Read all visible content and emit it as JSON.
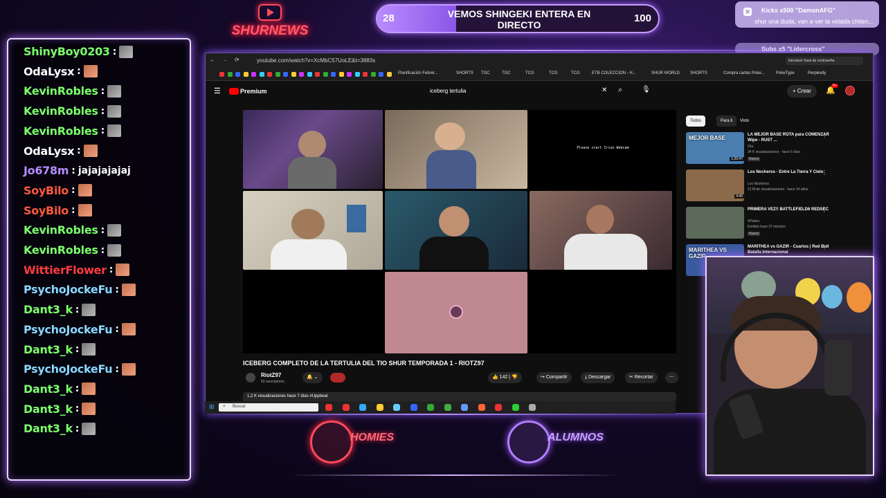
{
  "overlay": {
    "brand": "SHURNEWS",
    "goal": {
      "current": "28",
      "target": "100",
      "progress": 0.28,
      "title": "VEMOS SHINGEKI ENTERA EN DIRECTO"
    },
    "alerts": [
      {
        "title": "Kicks x500 \"DamonAFG\"",
        "message": "shur una duda, van a ver la velada chilen..."
      },
      {
        "title": "Subs x5 \"Lidercross\"",
        "message": ""
      }
    ],
    "teams": [
      "HOMIES",
      "ALUMNOS"
    ],
    "colors": {
      "accent": "#b98cff",
      "homies": "#ff4a5a",
      "alumnos": "#b47dff"
    }
  },
  "chat": [
    {
      "user": "ShinyBoy0203",
      "color": "#7dff6b",
      "msg": "",
      "emote": "gray"
    },
    {
      "user": "OdaLysx",
      "color": "#ffffff",
      "msg": "",
      "emote": "face"
    },
    {
      "user": "KevinRobles",
      "color": "#7dff6b",
      "msg": "",
      "emote": "gray"
    },
    {
      "user": "KevinRobles",
      "color": "#7dff6b",
      "msg": "",
      "emote": "gray"
    },
    {
      "user": "KevinRobles",
      "color": "#7dff6b",
      "msg": "",
      "emote": "gray"
    },
    {
      "user": "OdaLysx",
      "color": "#ffffff",
      "msg": "",
      "emote": "face"
    },
    {
      "user": "Jo678m",
      "color": "#b58cff",
      "msg": "jajajajajaj",
      "emote": ""
    },
    {
      "user": "SoyBilo",
      "color": "#ff5a3c",
      "msg": "",
      "emote": "face"
    },
    {
      "user": "SoyBilo",
      "color": "#ff5a3c",
      "msg": "",
      "emote": "face"
    },
    {
      "user": "KevinRobles",
      "color": "#7dff6b",
      "msg": "",
      "emote": "gray"
    },
    {
      "user": "KevinRobles",
      "color": "#7dff6b",
      "msg": "",
      "emote": "gray"
    },
    {
      "user": "WittierFlower",
      "color": "#ff3c3c",
      "msg": "",
      "emote": "face"
    },
    {
      "user": "PsychoJockeFu",
      "color": "#8ad7ff",
      "msg": "",
      "emote": "face"
    },
    {
      "user": "Dant3_k",
      "color": "#7dff6b",
      "msg": "",
      "emote": "gray"
    },
    {
      "user": "PsychoJockeFu",
      "color": "#8ad7ff",
      "msg": "",
      "emote": "face"
    },
    {
      "user": "Dant3_k",
      "color": "#7dff6b",
      "msg": "",
      "emote": "gray"
    },
    {
      "user": "PsychoJockeFu",
      "color": "#8ad7ff",
      "msg": "",
      "emote": "face"
    },
    {
      "user": "Dant3_k",
      "color": "#7dff6b",
      "msg": "",
      "emote": "face"
    },
    {
      "user": "Dant3_k",
      "color": "#7dff6b",
      "msg": "",
      "emote": "face"
    },
    {
      "user": "Dant3_k",
      "color": "#7dff6b",
      "msg": "",
      "emote": "gray"
    }
  ],
  "browser": {
    "url": "youtube.com/watch?v=XcMbC57UoLE&t=3883s",
    "bookmarks": [
      "Planificación Febrer...",
      "SHORTS",
      "TGC",
      "TGC",
      "TCG",
      "TCG",
      "TCG",
      "ETB COLECCION - H...",
      "SHUR WORLD",
      "SHORTS",
      "Compra cartas Poke...",
      "PokeType",
      "Perplexity"
    ],
    "extension_tooltip": "Introducir frase de contraseña",
    "yt": {
      "logo": "Premium",
      "search": "iceberg tertulia",
      "create": "Crear",
      "notif_count": "9+",
      "webcam_text": "Please start Iriun Webcam",
      "video_title": "ICEBERG COMPLETO DE LA TERTULIA DEL TIO SHUR TEMPORADA 1 - RIOTZ97",
      "channel": "RiotZ97",
      "subscribers": "50 suscriptores",
      "likes": "142",
      "share": "Compartir",
      "download": "Descargar",
      "clip": "Recortar",
      "views": "1,2 K visualizaciones  hace 7 días  #Uppbeat",
      "chips": [
        "Todos",
        "Para ti",
        "Visto"
      ],
      "recommended": [
        {
          "title": "LA MEJOR BASE ROTA para COMENZAR Wipe - RUST ...",
          "channel": "Oru",
          "meta": "34 K visualizaciones · hace 5 días",
          "badge": "Nuevo",
          "duration": "1:20:47",
          "thumb_text": "MEJOR BASE",
          "thumb": "#4a7db0"
        },
        {
          "title": "Los Nocheros - Entre La Tierra Y Cielo",
          "channel": "Los Nocheros",
          "meta": "21 M de visualizaciones · hace 14 años",
          "badge": "",
          "duration": "4:40",
          "thumb_text": "",
          "thumb": "#8a6a4a"
        },
        {
          "title": "PRIMERA VEZ!! BATTLEFIELD6 REDSEC",
          "channel": "XPaiiza",
          "meta": "Emitido hace 37 minutos",
          "badge": "Nuevo",
          "duration": "",
          "thumb_text": "",
          "thumb": "#5c6a5a"
        },
        {
          "title": "MARITHEA vs GAZIR - Cuartos | Red Bull Batalla Internacional",
          "channel": "",
          "meta": "",
          "badge": "",
          "duration": "",
          "thumb_text": "MARITHEA VS GAZIR",
          "thumb": "#3a5aa0"
        }
      ]
    },
    "taskbar_search": "Buscar"
  }
}
